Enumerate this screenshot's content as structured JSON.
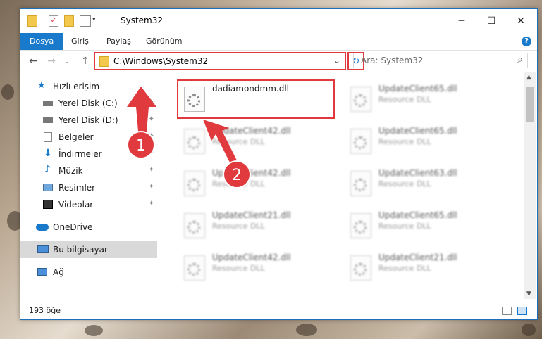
{
  "window": {
    "title": "System32",
    "controls": {
      "minimize": "─",
      "maximize": "☐",
      "close": "✕"
    }
  },
  "ribbon": {
    "tabs": [
      "Dosya",
      "Giriş",
      "Paylaş",
      "Görünüm"
    ],
    "help": "?"
  },
  "navigation": {
    "back": "←",
    "forward": "→",
    "recent": "⌄",
    "up": "↑",
    "address": "C:\\Windows\\System32",
    "address_dropdown": "⌄",
    "refresh": "↻",
    "search_placeholder": "Ara: System32",
    "search_icon": "⌕"
  },
  "sidebar": {
    "items": [
      {
        "label": "Hızlı erişim",
        "icon": "star-icon",
        "pinned": false
      },
      {
        "label": "Yerel Disk (C:)",
        "icon": "drive-icon",
        "pinned": true
      },
      {
        "label": "Yerel Disk (D:)",
        "icon": "drive-icon",
        "pinned": true
      },
      {
        "label": "Belgeler",
        "icon": "documents-icon",
        "pinned": true
      },
      {
        "label": "İndirmeler",
        "icon": "download-icon",
        "pinned": true
      },
      {
        "label": "Müzik",
        "icon": "music-icon",
        "pinned": true
      },
      {
        "label": "Resimler",
        "icon": "pictures-icon",
        "pinned": true
      },
      {
        "label": "Videolar",
        "icon": "videos-icon",
        "pinned": true
      },
      {
        "label": "OneDrive",
        "icon": "cloud-icon",
        "pinned": false
      },
      {
        "label": "Bu bilgisayar",
        "icon": "computer-icon",
        "pinned": false,
        "selected": true
      },
      {
        "label": "Ağ",
        "icon": "network-icon",
        "pinned": false
      }
    ],
    "pin_glyph": "📌"
  },
  "files": [
    {
      "name": "dadiamondmm.dll",
      "type": ""
    },
    {
      "name": "UpdateClient65.dll",
      "type": "Resource DLL"
    },
    {
      "name": "UpdateClient42.dll",
      "type": "Resource DLL"
    },
    {
      "name": "UpdateClient65.dll",
      "type": "Resource DLL"
    },
    {
      "name": "UpdateClient42.dll",
      "type": "Resource DLL"
    },
    {
      "name": "UpdateClient63.dll",
      "type": "Resource DLL"
    },
    {
      "name": "UpdateClient21.dll",
      "type": "Resource DLL"
    },
    {
      "name": "UpdateClient65.dll",
      "type": "Resource DLL"
    },
    {
      "name": "UpdateClient42.dll",
      "type": "Resource DLL"
    },
    {
      "name": "UpdateClient21.dll",
      "type": "Resource DLL"
    }
  ],
  "status": {
    "count": "193 öğe"
  },
  "annotations": {
    "step1": "1",
    "step2": "2"
  },
  "colors": {
    "accent": "#1979ca",
    "highlight": "#e0393e"
  }
}
